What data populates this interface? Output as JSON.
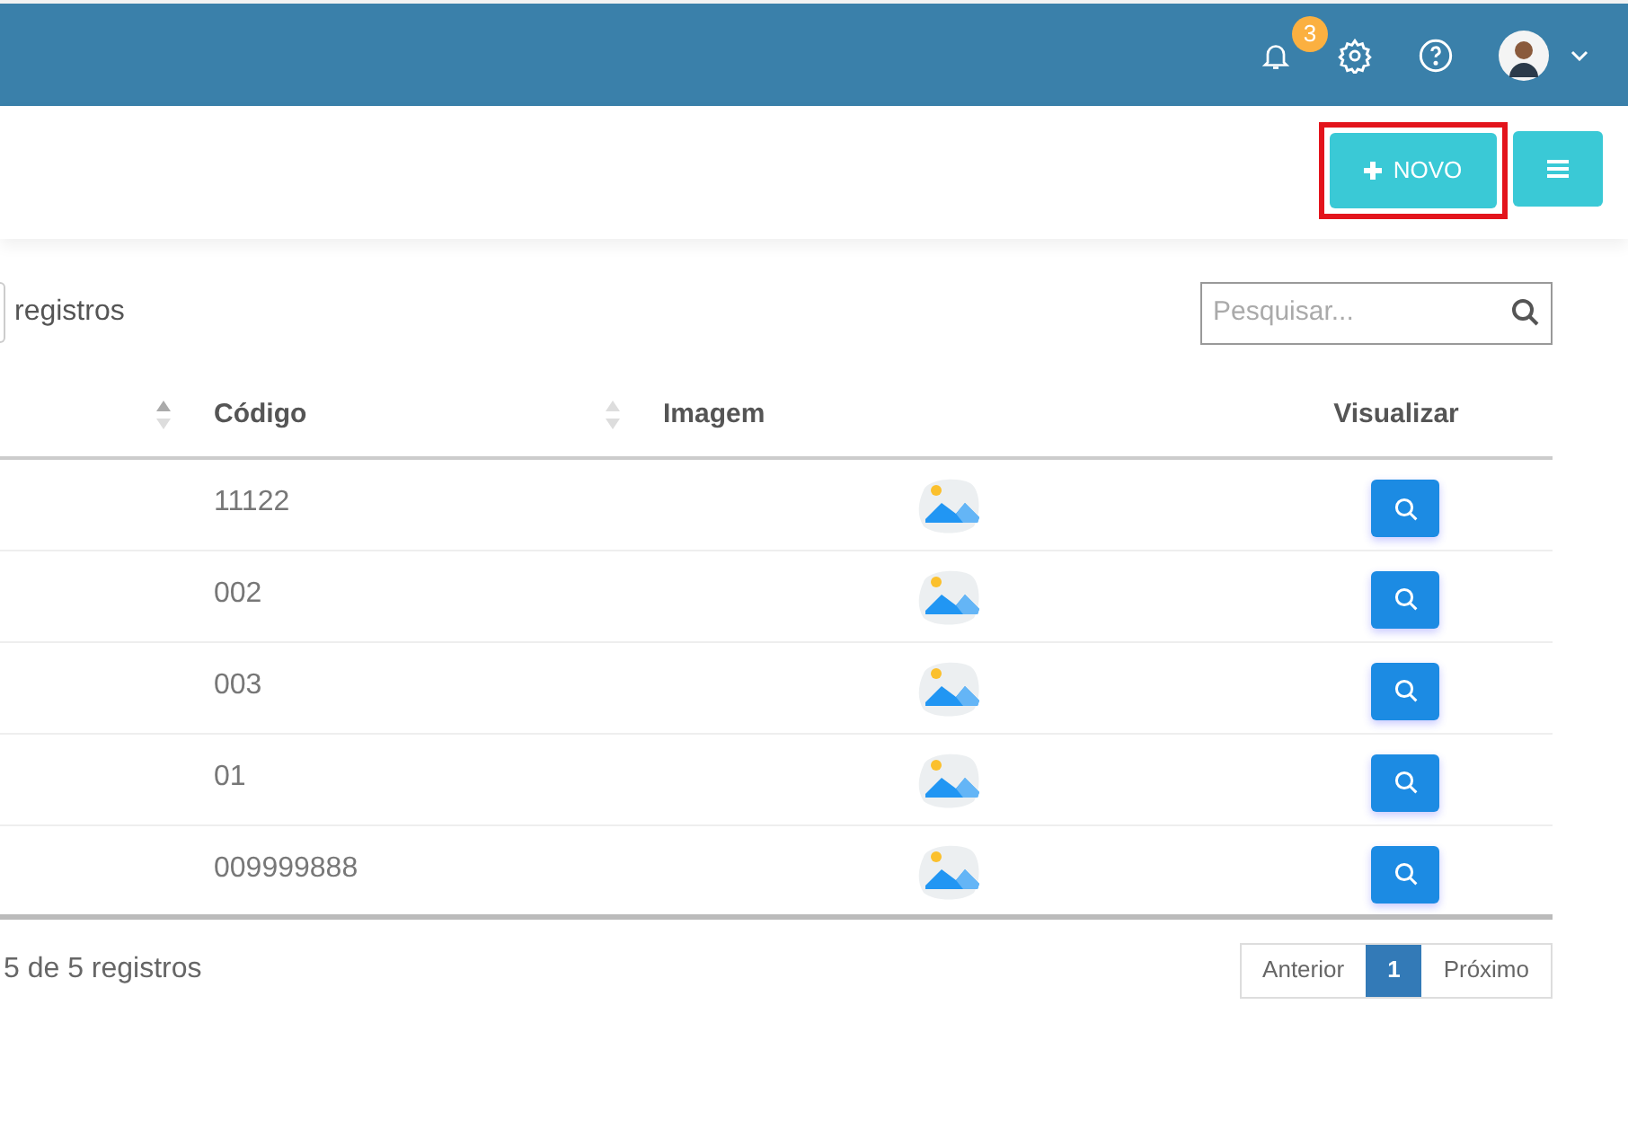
{
  "topbar": {
    "notifications": {
      "count": "3"
    }
  },
  "toolbar": {
    "new_button": {
      "label": "NOVO",
      "highlighted": true
    }
  },
  "length_control": {
    "label": "registros"
  },
  "search": {
    "placeholder": "Pesquisar..."
  },
  "table": {
    "columns": [
      {
        "sorted": true
      },
      {
        "label": "Código",
        "sorted": false
      },
      {
        "label": "Imagem"
      },
      {
        "label": "Visualizar"
      }
    ],
    "rows": [
      {
        "code": "11122"
      },
      {
        "code": "002"
      },
      {
        "code": "003"
      },
      {
        "code": "01"
      },
      {
        "code": "009999888"
      }
    ]
  },
  "info": "5 de 5 registros",
  "pagination": [
    {
      "label": "Anterior",
      "selected": false
    },
    {
      "label": "1",
      "selected": true
    },
    {
      "label": "Próximo",
      "selected": false
    }
  ]
}
